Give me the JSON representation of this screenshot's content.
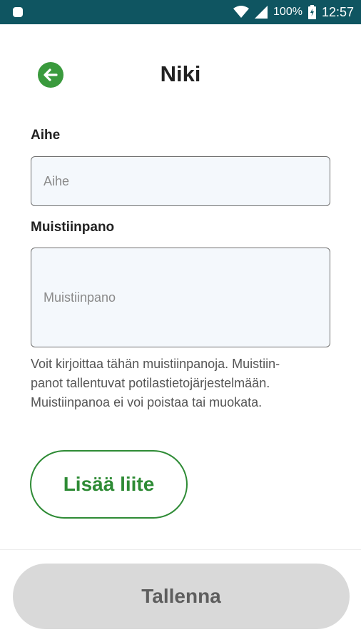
{
  "status_bar": {
    "battery_percent": "100%",
    "time": "12:57",
    "icons": [
      "app-notification-icon",
      "wifi-icon",
      "cellular-signal-icon",
      "battery-icon"
    ]
  },
  "header": {
    "title": "Niki",
    "back_icon": "arrow-left-circle-icon"
  },
  "form": {
    "subject_label": "Aihe",
    "subject_placeholder": "Aihe",
    "note_label": "Muistiinpano",
    "note_placeholder": "Muistiinpano",
    "helper_lines": [
      "Voit kirjoittaa tähän muistiinpanoja. Muistiin-",
      "panot tallentuvat potilastietojärjestelmään.",
      "Muistiinpanoa ei voi poistaa tai muokata."
    ]
  },
  "buttons": {
    "attach_label": "Lisää liite",
    "save_label": "Tallenna"
  },
  "colors": {
    "status_bar": "#0f5561",
    "accent_green": "#2e8b35",
    "field_bg": "#f4f8fc",
    "save_disabled_bg": "#d9d9d9"
  }
}
